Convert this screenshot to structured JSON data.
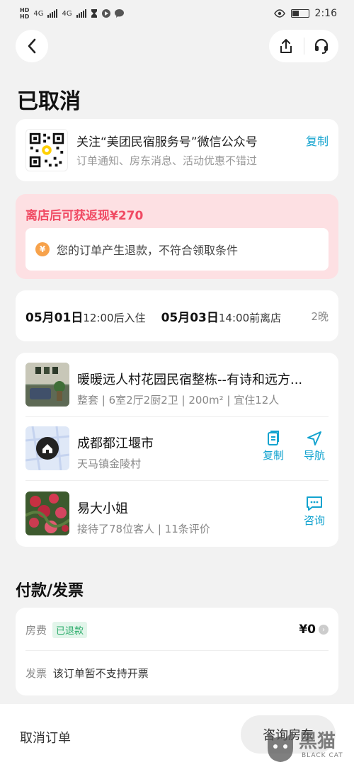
{
  "status_bar": {
    "network_1": "4G",
    "network_2": "4G",
    "time": "2:16"
  },
  "header": {
    "back_icon": "chevron-left-icon",
    "share_icon": "share-icon",
    "support_icon": "headset-icon"
  },
  "page_title": "已取消",
  "follow_card": {
    "title": "关注“美团民宿服务号”微信公众号",
    "subtitle": "订单通知、房东消息、活动优惠不错过",
    "copy_label": "复制"
  },
  "cashback": {
    "title": "离店后可获返现¥270",
    "icon_glyph": "¥",
    "message": "您的订单产生退款，不符合领取条件"
  },
  "dates": {
    "checkin_date": "05月01日",
    "checkin_time": "12:00后入住",
    "checkout_date": "05月03日",
    "checkout_time": "14:00前离店",
    "nights": "2晚"
  },
  "property": {
    "name": "暖暖远人村花园民宿整栋--有诗和远方...",
    "details": "整套 | 6室2厅2厨2卫 | 200m² | 宜住12人"
  },
  "location": {
    "city": "成都都江堰市",
    "address": "天马镇金陵村",
    "copy_label": "复制",
    "navigate_label": "导航"
  },
  "host": {
    "name": "易大小姐",
    "stats": "接待了78位客人 | 11条评价",
    "consult_label": "咨询"
  },
  "payment": {
    "section_title": "付款/发票",
    "fee_label": "房费",
    "refund_badge": "已退款",
    "amount": "¥0",
    "invoice_label": "发票",
    "invoice_text": "该订单暂不支持开票"
  },
  "bottom_bar": {
    "cancel_label": "取消订单",
    "consult_host_label": "咨询房东"
  },
  "watermark": {
    "text": "黑猫",
    "sub": "BLACK CAT"
  },
  "colors": {
    "accent": "#13a3cf",
    "cashback_bg": "#fde0e3",
    "cashback_title": "#f04a63",
    "refund_green": "#2aab6a"
  }
}
